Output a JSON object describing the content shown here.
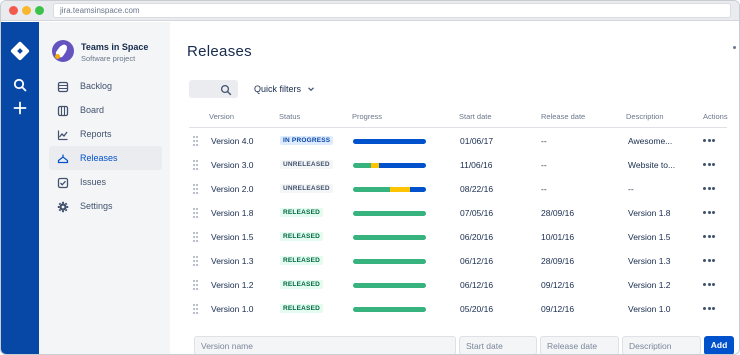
{
  "browser": {
    "url": "jira.teamsinspace.com"
  },
  "project": {
    "name": "Teams in Space",
    "type": "Software project"
  },
  "sidebar": {
    "items": [
      {
        "label": "Backlog",
        "icon": "backlog-icon"
      },
      {
        "label": "Board",
        "icon": "board-icon"
      },
      {
        "label": "Reports",
        "icon": "reports-icon"
      },
      {
        "label": "Releases",
        "icon": "releases-icon",
        "active": true
      },
      {
        "label": "Issues",
        "icon": "issues-icon"
      },
      {
        "label": "Settings",
        "icon": "gear-icon"
      }
    ]
  },
  "page": {
    "title": "Releases",
    "quick_filters": "Quick filters"
  },
  "table": {
    "headers": {
      "version": "Version",
      "status": "Status",
      "progress": "Progress",
      "start": "Start date",
      "release": "Release date",
      "description": "Description",
      "actions": "Actions"
    },
    "rows": [
      {
        "version": "Version 4.0",
        "status": "IN PROGRESS",
        "status_kind": "inprogress",
        "progress": {
          "done": 0,
          "in_progress": 0,
          "todo": 1
        },
        "start": "01/06/17",
        "release": "--",
        "description": "Awesome..."
      },
      {
        "version": "Version 3.0",
        "status": "UNRELEASED",
        "status_kind": "unreleased",
        "progress": {
          "done": 0.25,
          "in_progress": 0.1,
          "todo": 0.65
        },
        "start": "11/06/16",
        "release": "--",
        "description": "Website to..."
      },
      {
        "version": "Version 2.0",
        "status": "UNRELEASED",
        "status_kind": "unreleased",
        "progress": {
          "done": 0.5,
          "in_progress": 0.28,
          "todo": 0.22
        },
        "start": "08/22/16",
        "release": "--",
        "description": "--"
      },
      {
        "version": "Version 1.8",
        "status": "RELEASED",
        "status_kind": "released",
        "progress": {
          "done": 1,
          "in_progress": 0,
          "todo": 0
        },
        "start": "07/05/16",
        "release": "28/09/16",
        "description": "Version 1.8"
      },
      {
        "version": "Version 1.5",
        "status": "RELEASED",
        "status_kind": "released",
        "progress": {
          "done": 1,
          "in_progress": 0,
          "todo": 0
        },
        "start": "06/20/16",
        "release": "10/01/16",
        "description": "Version 1.5"
      },
      {
        "version": "Version 1.3",
        "status": "RELEASED",
        "status_kind": "released",
        "progress": {
          "done": 1,
          "in_progress": 0,
          "todo": 0
        },
        "start": "06/12/16",
        "release": "28/09/16",
        "description": "Version 1.3"
      },
      {
        "version": "Version 1.2",
        "status": "RELEASED",
        "status_kind": "released",
        "progress": {
          "done": 1,
          "in_progress": 0,
          "todo": 0
        },
        "start": "06/12/16",
        "release": "09/12/16",
        "description": "Version 1.2"
      },
      {
        "version": "Version 1.0",
        "status": "RELEASED",
        "status_kind": "released",
        "progress": {
          "done": 1,
          "in_progress": 0,
          "todo": 0
        },
        "start": "05/20/16",
        "release": "09/12/16",
        "description": "Version 1.0"
      }
    ]
  },
  "new_version": {
    "name_placeholder": "Version name",
    "start_placeholder": "Start date",
    "release_placeholder": "Release date",
    "description_placeholder": "Description",
    "add_label": "Add"
  },
  "colors": {
    "done": "#36b37e",
    "in_progress": "#ffc400",
    "todo": "#0052cc",
    "nav": "#0747a6"
  }
}
